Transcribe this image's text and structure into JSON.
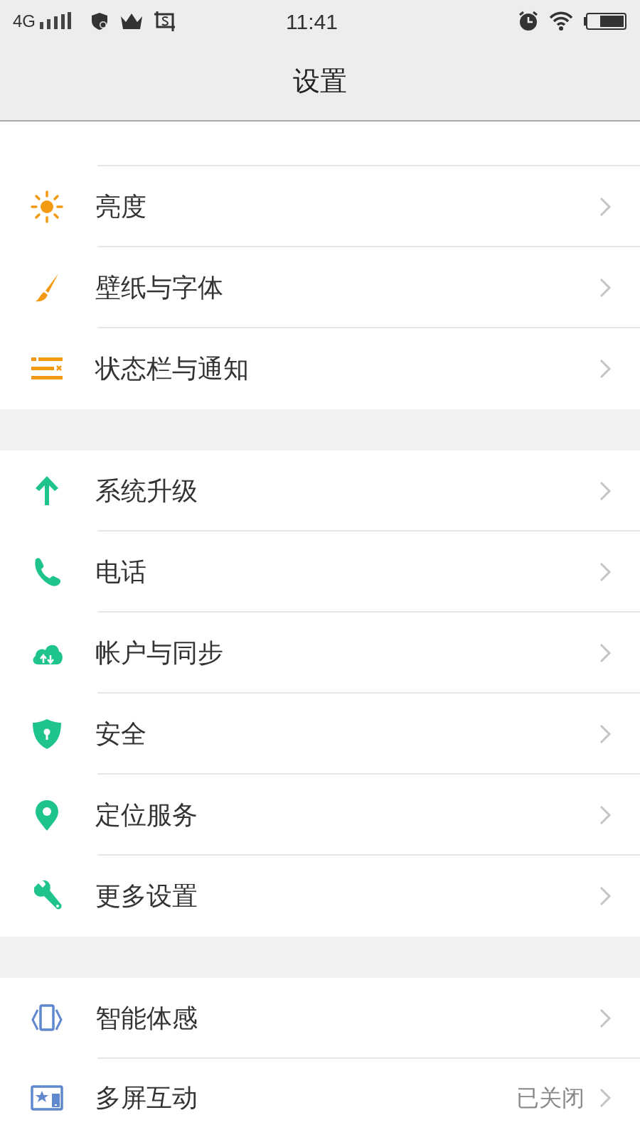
{
  "status_bar": {
    "network": "4G",
    "time": "11:41"
  },
  "title": "设置",
  "sections": [
    {
      "items": [
        {
          "label": "亮度"
        },
        {
          "label": "壁纸与字体"
        },
        {
          "label": "状态栏与通知"
        }
      ]
    },
    {
      "items": [
        {
          "label": "系统升级"
        },
        {
          "label": "电话"
        },
        {
          "label": "帐户与同步"
        },
        {
          "label": "安全"
        },
        {
          "label": "定位服务"
        },
        {
          "label": "更多设置"
        }
      ]
    },
    {
      "items": [
        {
          "label": "智能体感"
        },
        {
          "label": "多屏互动",
          "value": "已关闭"
        }
      ]
    }
  ]
}
